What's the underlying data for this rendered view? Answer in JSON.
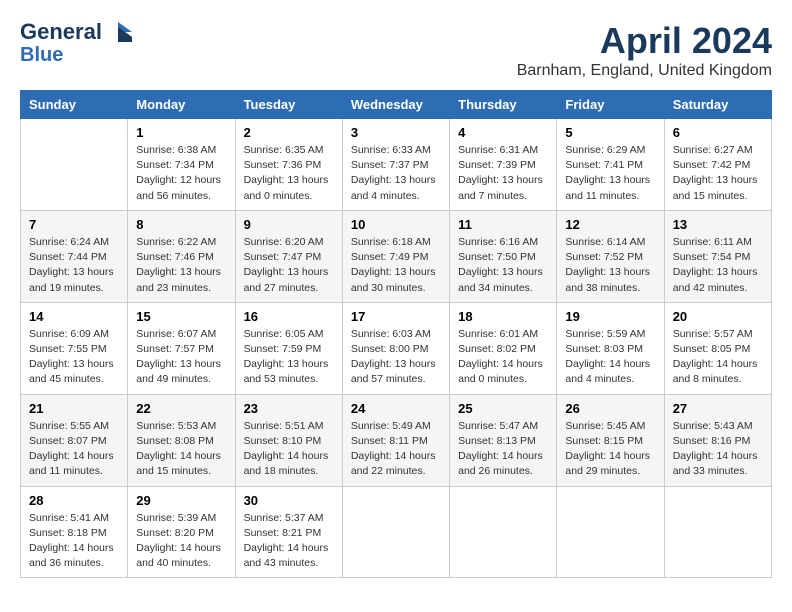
{
  "header": {
    "logo_line1": "General",
    "logo_line2": "Blue",
    "month_title": "April 2024",
    "location": "Barnham, England, United Kingdom"
  },
  "columns": [
    "Sunday",
    "Monday",
    "Tuesday",
    "Wednesday",
    "Thursday",
    "Friday",
    "Saturday"
  ],
  "weeks": [
    [
      {
        "day": "",
        "info": ""
      },
      {
        "day": "1",
        "info": "Sunrise: 6:38 AM\nSunset: 7:34 PM\nDaylight: 12 hours\nand 56 minutes."
      },
      {
        "day": "2",
        "info": "Sunrise: 6:35 AM\nSunset: 7:36 PM\nDaylight: 13 hours\nand 0 minutes."
      },
      {
        "day": "3",
        "info": "Sunrise: 6:33 AM\nSunset: 7:37 PM\nDaylight: 13 hours\nand 4 minutes."
      },
      {
        "day": "4",
        "info": "Sunrise: 6:31 AM\nSunset: 7:39 PM\nDaylight: 13 hours\nand 7 minutes."
      },
      {
        "day": "5",
        "info": "Sunrise: 6:29 AM\nSunset: 7:41 PM\nDaylight: 13 hours\nand 11 minutes."
      },
      {
        "day": "6",
        "info": "Sunrise: 6:27 AM\nSunset: 7:42 PM\nDaylight: 13 hours\nand 15 minutes."
      }
    ],
    [
      {
        "day": "7",
        "info": "Sunrise: 6:24 AM\nSunset: 7:44 PM\nDaylight: 13 hours\nand 19 minutes."
      },
      {
        "day": "8",
        "info": "Sunrise: 6:22 AM\nSunset: 7:46 PM\nDaylight: 13 hours\nand 23 minutes."
      },
      {
        "day": "9",
        "info": "Sunrise: 6:20 AM\nSunset: 7:47 PM\nDaylight: 13 hours\nand 27 minutes."
      },
      {
        "day": "10",
        "info": "Sunrise: 6:18 AM\nSunset: 7:49 PM\nDaylight: 13 hours\nand 30 minutes."
      },
      {
        "day": "11",
        "info": "Sunrise: 6:16 AM\nSunset: 7:50 PM\nDaylight: 13 hours\nand 34 minutes."
      },
      {
        "day": "12",
        "info": "Sunrise: 6:14 AM\nSunset: 7:52 PM\nDaylight: 13 hours\nand 38 minutes."
      },
      {
        "day": "13",
        "info": "Sunrise: 6:11 AM\nSunset: 7:54 PM\nDaylight: 13 hours\nand 42 minutes."
      }
    ],
    [
      {
        "day": "14",
        "info": "Sunrise: 6:09 AM\nSunset: 7:55 PM\nDaylight: 13 hours\nand 45 minutes."
      },
      {
        "day": "15",
        "info": "Sunrise: 6:07 AM\nSunset: 7:57 PM\nDaylight: 13 hours\nand 49 minutes."
      },
      {
        "day": "16",
        "info": "Sunrise: 6:05 AM\nSunset: 7:59 PM\nDaylight: 13 hours\nand 53 minutes."
      },
      {
        "day": "17",
        "info": "Sunrise: 6:03 AM\nSunset: 8:00 PM\nDaylight: 13 hours\nand 57 minutes."
      },
      {
        "day": "18",
        "info": "Sunrise: 6:01 AM\nSunset: 8:02 PM\nDaylight: 14 hours\nand 0 minutes."
      },
      {
        "day": "19",
        "info": "Sunrise: 5:59 AM\nSunset: 8:03 PM\nDaylight: 14 hours\nand 4 minutes."
      },
      {
        "day": "20",
        "info": "Sunrise: 5:57 AM\nSunset: 8:05 PM\nDaylight: 14 hours\nand 8 minutes."
      }
    ],
    [
      {
        "day": "21",
        "info": "Sunrise: 5:55 AM\nSunset: 8:07 PM\nDaylight: 14 hours\nand 11 minutes."
      },
      {
        "day": "22",
        "info": "Sunrise: 5:53 AM\nSunset: 8:08 PM\nDaylight: 14 hours\nand 15 minutes."
      },
      {
        "day": "23",
        "info": "Sunrise: 5:51 AM\nSunset: 8:10 PM\nDaylight: 14 hours\nand 18 minutes."
      },
      {
        "day": "24",
        "info": "Sunrise: 5:49 AM\nSunset: 8:11 PM\nDaylight: 14 hours\nand 22 minutes."
      },
      {
        "day": "25",
        "info": "Sunrise: 5:47 AM\nSunset: 8:13 PM\nDaylight: 14 hours\nand 26 minutes."
      },
      {
        "day": "26",
        "info": "Sunrise: 5:45 AM\nSunset: 8:15 PM\nDaylight: 14 hours\nand 29 minutes."
      },
      {
        "day": "27",
        "info": "Sunrise: 5:43 AM\nSunset: 8:16 PM\nDaylight: 14 hours\nand 33 minutes."
      }
    ],
    [
      {
        "day": "28",
        "info": "Sunrise: 5:41 AM\nSunset: 8:18 PM\nDaylight: 14 hours\nand 36 minutes."
      },
      {
        "day": "29",
        "info": "Sunrise: 5:39 AM\nSunset: 8:20 PM\nDaylight: 14 hours\nand 40 minutes."
      },
      {
        "day": "30",
        "info": "Sunrise: 5:37 AM\nSunset: 8:21 PM\nDaylight: 14 hours\nand 43 minutes."
      },
      {
        "day": "",
        "info": ""
      },
      {
        "day": "",
        "info": ""
      },
      {
        "day": "",
        "info": ""
      },
      {
        "day": "",
        "info": ""
      }
    ]
  ]
}
